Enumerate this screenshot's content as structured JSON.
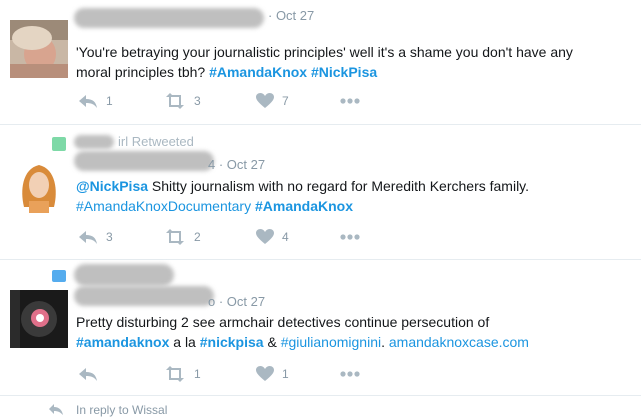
{
  "tweets": [
    {
      "name_partial": "Lily Coursey",
      "handle_partial": "@lily_",
      "time": "· Oct 27",
      "line1": "'You're betraying your journalistic principles' well it's a shame you don't have any",
      "line2_text": "moral principles tbh? ",
      "line2_tag1": "#AmandaKnox",
      "line2_tag2": "#NickPisa",
      "reply_count": "1",
      "retweet_count": "3",
      "like_count": "7"
    },
    {
      "retweet_note": "irl Retweeted",
      "time": "4 · Oct 27",
      "mention": "@NickPisa",
      "line1_rest": " Shitty journalism with no regard for Meredith Kerchers family.",
      "line2_tag1": "#AmandaKnoxDocumentary",
      "line2_tag2": "#AmandaKnox",
      "reply_count": "3",
      "retweet_count": "2",
      "like_count": "4"
    },
    {
      "time": "o · Oct 27",
      "line1": "Pretty disturbing 2 see armchair detectives continue persecution of",
      "tag1": "#amandaknox",
      "mid1": " a la ",
      "tag2": "#nickpisa",
      "mid2": " & ",
      "tag3": "#giulianomignini",
      "mid3": ".  ",
      "link": "amandaknoxcase.com",
      "reply_count": "",
      "retweet_count": "1",
      "like_count": "1"
    }
  ],
  "footer": {
    "reply_note": "In reply to Wissal"
  },
  "colors": {
    "link": "#1b95e0",
    "icon": "#aab8c2",
    "muted": "#8899a6",
    "border": "#e6ecf0"
  }
}
